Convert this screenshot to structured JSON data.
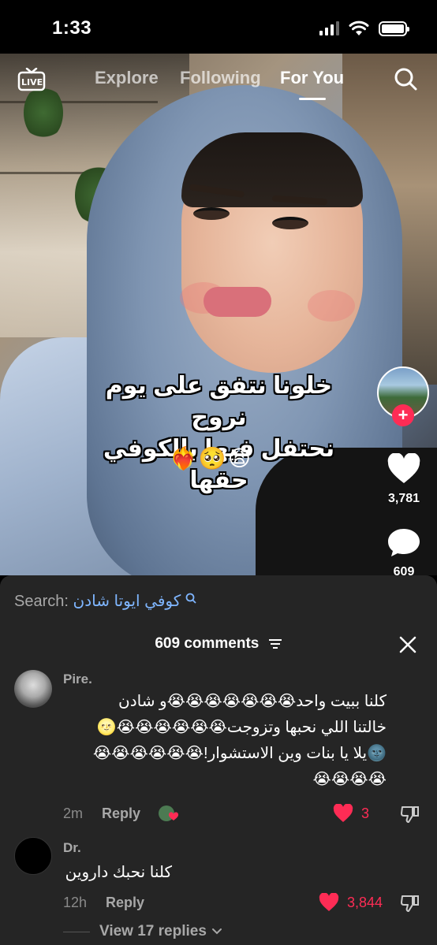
{
  "status": {
    "time": "1:33"
  },
  "nav": {
    "live_label": "LIVE",
    "tabs": [
      {
        "label": "Explore"
      },
      {
        "label": "Following"
      },
      {
        "label": "For You"
      }
    ]
  },
  "video": {
    "caption_line1": "خلونا نتفق على يوم نروح",
    "caption_line2": "نحتفل فيها بالكوفي حقها",
    "caption_emojis": "❤️‍🔥🥺😩",
    "likes": "3,781",
    "comments": "609"
  },
  "sheet": {
    "search_label": "Search:",
    "search_term": "كوفي ايوتا شادن",
    "comments_count": "609 comments",
    "comments": [
      {
        "user": "Pire.",
        "text_lines": [
          "كلنا ببيت واحد😭😭😭😭😭😭😭و شادن",
          "خالتنا اللي نحبها وتزوجت😭😭😭😭😭😭🌝",
          "🌚يلا يا بنات وين الاستشوار!😭😭😭😭😭😭",
          "😭😭😭😭"
        ],
        "time": "2m",
        "reply_label": "Reply",
        "likes": "3"
      },
      {
        "user": "Dr.",
        "text_lines": [
          "كلنا نحبك داروين"
        ],
        "time": "12h",
        "reply_label": "Reply",
        "likes": "3,844"
      }
    ],
    "view_replies": "View 17 replies"
  }
}
